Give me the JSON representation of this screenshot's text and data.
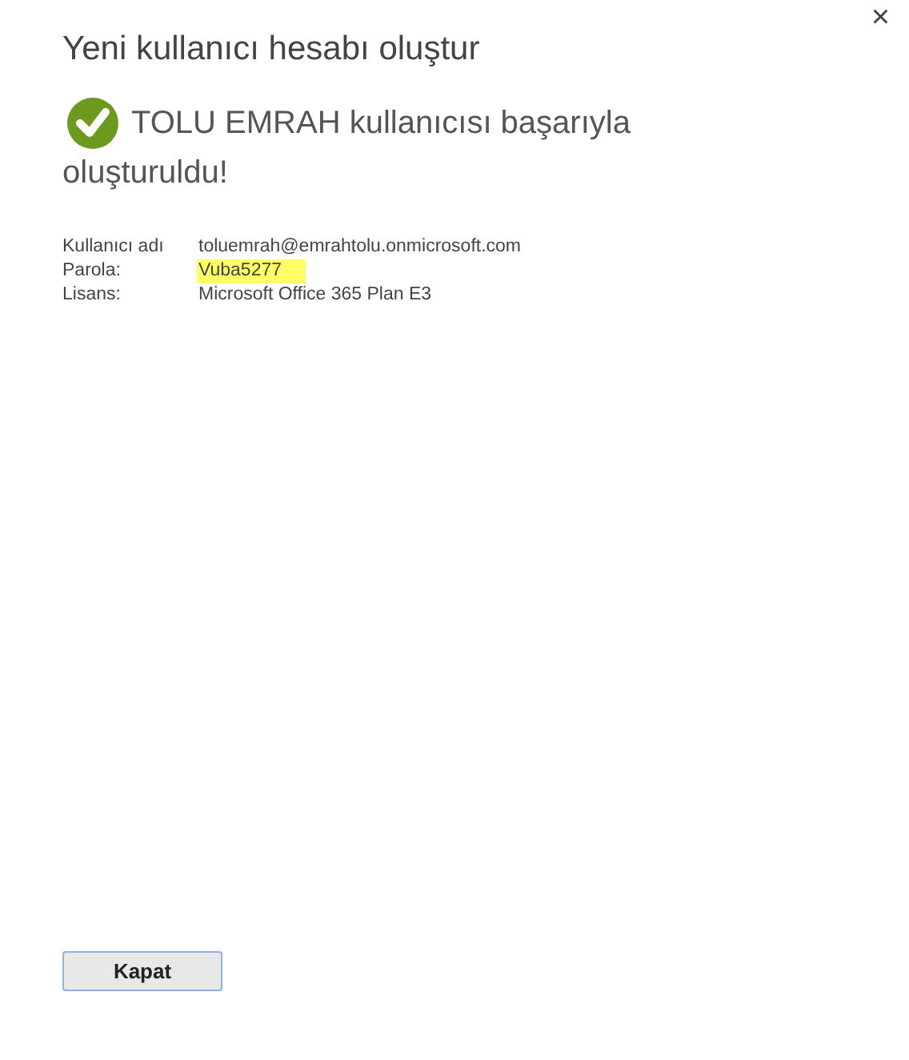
{
  "dialog": {
    "title": "Yeni kullanıcı hesabı oluştur",
    "close": "×"
  },
  "message_lines": [
    "TOLU EMRAH kullanıcısı başarıyla",
    "oluşturuldu!"
  ],
  "details": [
    {
      "label": "Kullanıcı adı",
      "value": "toluemrah@emrahtolu.onmicrosoft.com",
      "highlighted": false
    },
    {
      "label": "Parola:",
      "value": "Vuba5277",
      "highlighted": true
    },
    {
      "label": "Lisans:",
      "value": "Microsoft Office 365 Plan E3",
      "highlighted": false
    }
  ],
  "buttons": [
    "Kapat"
  ]
}
